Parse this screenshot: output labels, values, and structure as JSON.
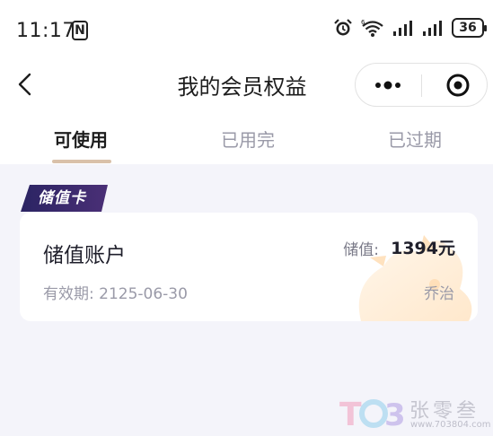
{
  "status_bar": {
    "time": "11:17",
    "nfc": "N",
    "battery": "36",
    "icons": [
      "alarm-icon",
      "wifi-icon",
      "signal-icon",
      "signal-icon",
      "battery-icon"
    ]
  },
  "nav": {
    "title": "我的会员权益",
    "back_icon": "chevron-left-icon",
    "more_icon": "more-dots-icon",
    "close_icon": "target-circle-icon"
  },
  "tabs": [
    {
      "label": "可使用",
      "active": true
    },
    {
      "label": "已用完",
      "active": false
    },
    {
      "label": "已过期",
      "active": false
    }
  ],
  "card": {
    "badge": "储值卡",
    "title": "储值账户",
    "balance_label": "储值:",
    "balance_value": "1394元",
    "expiry": "有效期: 2125-06-30",
    "store": "乔治"
  },
  "watermark": {
    "logo": "T03",
    "name": "张零叁",
    "url": "www.703804.com"
  },
  "colors": {
    "accent_underline": "#d9c1a9",
    "badge_bg": "#3b2a6e",
    "page_bg": "#f4f4fa"
  }
}
